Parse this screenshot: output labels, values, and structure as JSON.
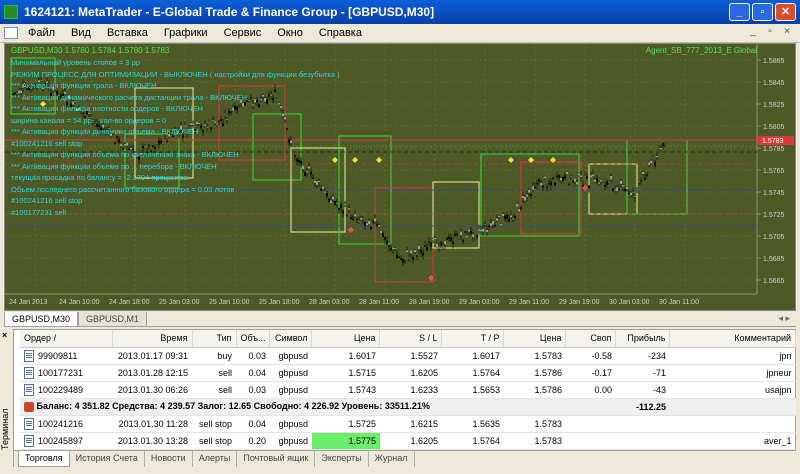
{
  "window": {
    "title": "1624121: MetaTrader - E-Global Trade & Finance Group - [GBPUSD,M30]"
  },
  "menu": {
    "items": [
      "Файл",
      "Вид",
      "Вставка",
      "Графики",
      "Сервис",
      "Окно",
      "Справка"
    ]
  },
  "chart": {
    "header": "GBPUSD,M30  1.5780 1.5784 1.5780 1.5783",
    "ea_name": "Agent_SB_777_2013_E Global",
    "current_price": "1.5783",
    "info_lines": [
      "Минимальный уровень стопов =  3  pp",
      "РЕЖИМ ПРОЦЕСС ДЛЯ ОПТИМИЗАЦИИ -  ВЫКЛЮЧЕН  ( настройки для функции безубытка )",
      "*** Активация функции трала -  ВКЛЮЧЕН",
      "*** Активация динамического расчета дистанции трала -  ВКЛЮЧЕН",
      "*** Активация фильтра плотности ордеров -  ВКЛЮЧЕН",
      "ширина канала = 54 pp. ,  кол-во ордеров =  0",
      "*** Активация функции динамики объема -  ВКЛЮЧЕН",
      "#100241216 sell stop",
      "*** Активация функции объема по увеличению знака -  ВКЛЮЧЕН",
      "*** Активация функции объема по ... перебора -  ВКЛЮЧЕН",
      "текущая просадка по балансу = -2.3794 процентов",
      "Объем последнего рассчитанного базового ордера =  0.03 лотов",
      "#100241216 sell stop",
      "#100177231 sell"
    ],
    "price_labels": [
      "1.5865",
      "1.5845",
      "1.5825",
      "1.5805",
      "1.5785",
      "1.5765",
      "1.5745",
      "1.5725",
      "1.5705",
      "1.5685",
      "1.5665"
    ],
    "time_labels": [
      "24 Jan 2013",
      "24 Jan 10:00",
      "24 Jan 18:00",
      "25 Jan 03:00",
      "25 Jan 10:00",
      "25 Jan 18:00",
      "28 Jan 03:00",
      "28 Jan 11:00",
      "28 Jan 19:00",
      "29 Jan 03:00",
      "29 Jan 11:00",
      "29 Jan 19:00",
      "30 Jan 03:00",
      "30 Jan 11:00"
    ]
  },
  "chart_tabs": [
    "GBPUSD,M30",
    "GBPUSD,M1"
  ],
  "terminal": {
    "label": "Терминал",
    "columns": [
      "Ордер",
      "/",
      "Время",
      "Тип",
      "Объ...",
      "Символ",
      "Цена",
      "S / L",
      "T / P",
      "Цена",
      "Своп",
      "Прибыль",
      "Комментарий"
    ],
    "rows": [
      {
        "order": "99909811",
        "time": "2013.01.17 09:31",
        "type": "buy",
        "vol": "0.03",
        "symbol": "gbpusd",
        "price": "1.6017",
        "sl": "1.5527",
        "tp": "1.6017",
        "cur": "1.5783",
        "swap": "-0.58",
        "profit": "-234",
        "comment": "jpn"
      },
      {
        "order": "100177231",
        "time": "2013.01.28 12:15",
        "type": "sell",
        "vol": "0.04",
        "symbol": "gbpusd",
        "price": "1.5715",
        "sl": "1.6205",
        "tp": "1.5764",
        "cur": "1.5786",
        "swap": "-0.17",
        "profit": "-71",
        "comment": "jpneur"
      },
      {
        "order": "100229489",
        "time": "2013.01.30 06:26",
        "type": "sell",
        "vol": "0.03",
        "symbol": "gbpusd",
        "price": "1.5743",
        "sl": "1.6233",
        "tp": "1.5653",
        "cur": "1.5786",
        "swap": "0.00",
        "profit": "-43",
        "comment": "usajpn"
      }
    ],
    "balance": {
      "text": "Баланс: 4 351.82  Средства: 4 239.57  Залог: 12.65  Свободно: 4 226.92  Уровень: 33511.21%",
      "profit": "-112.25"
    },
    "pending": [
      {
        "order": "100241216",
        "time": "2013.01.30 11:28",
        "type": "sell stop",
        "vol": "0.04",
        "symbol": "gbpusd",
        "price": "1.5725",
        "sl": "1.6215",
        "tp": "1.5635",
        "cur": "1.5783",
        "comment": ""
      },
      {
        "order": "100245897",
        "time": "2013.01.30 13:28",
        "type": "sell stop",
        "vol": "0.20",
        "symbol": "gbpusd",
        "price": "1.5775",
        "sl": "1.6205",
        "tp": "1.5764",
        "cur": "1.5783",
        "comment": "aver_1"
      }
    ]
  },
  "bottom_tabs": [
    "Торговля",
    "История Счета",
    "Новости",
    "Алерты",
    "Почтовый ящик",
    "Эксперты",
    "Журнал"
  ],
  "colors": {
    "chart_bg": "#4e5a25",
    "candle": "#000000",
    "price_line": "#ff3030",
    "info_text": "#28d8d8"
  }
}
